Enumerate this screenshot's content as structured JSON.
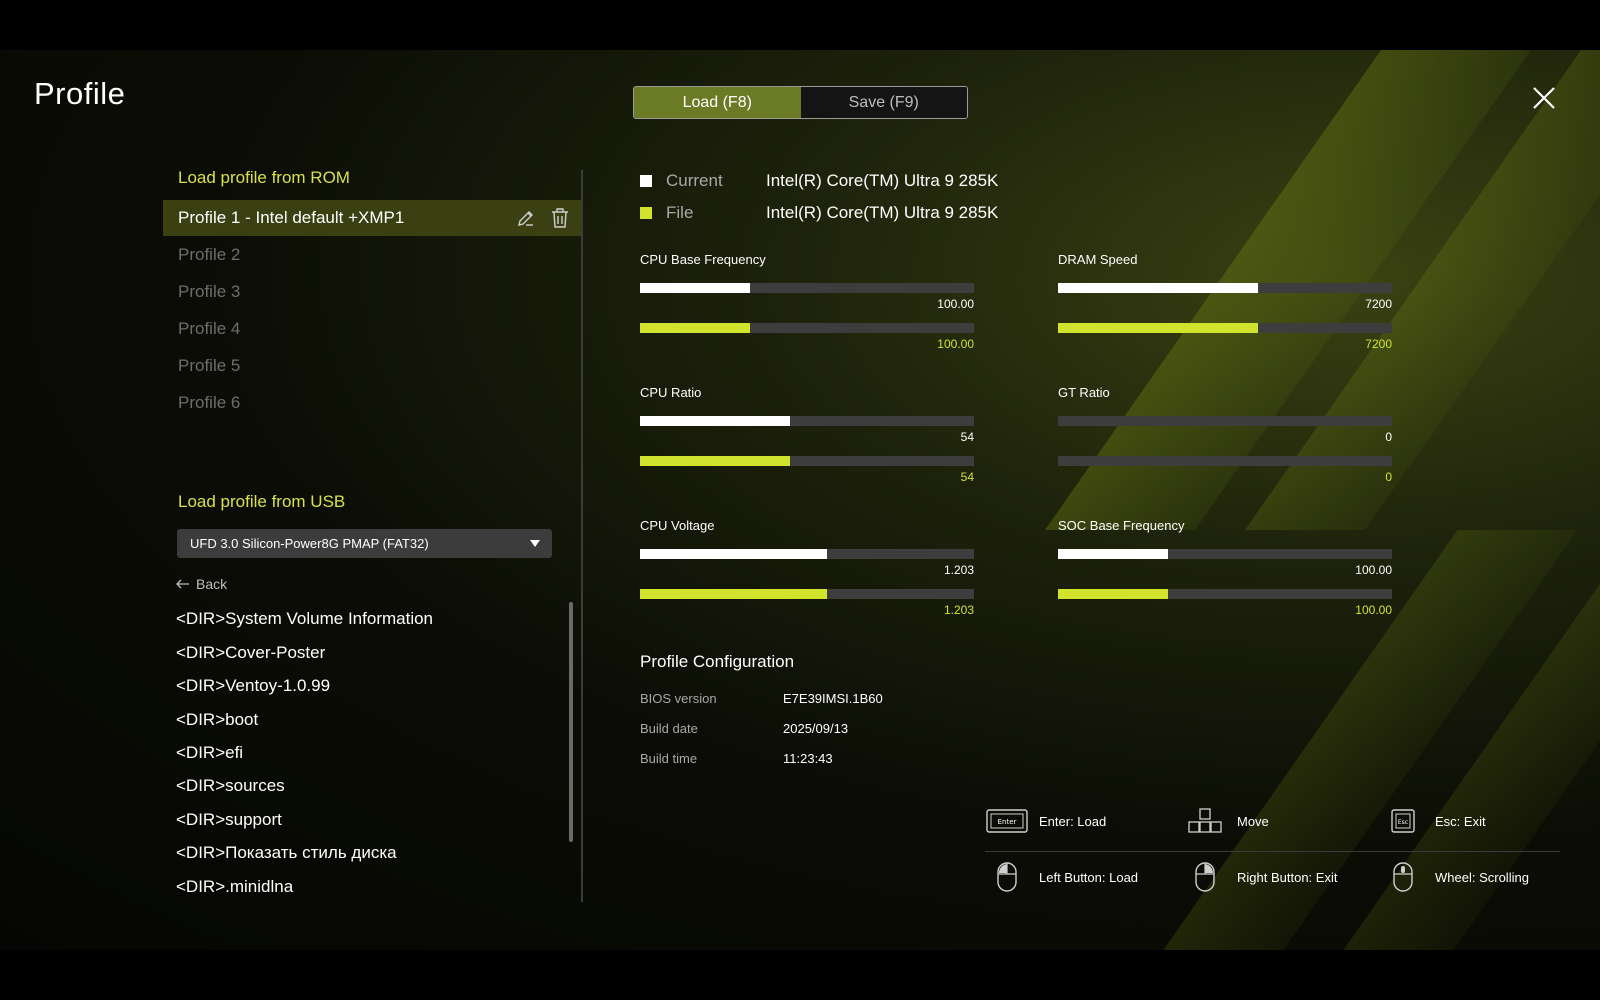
{
  "title": "Profile",
  "close_icon": "close-icon",
  "tabs": {
    "load": "Load (F8)",
    "save": "Save (F9)",
    "active": "load"
  },
  "rom": {
    "section_title": "Load profile from ROM",
    "profiles": [
      "Profile 1 - Intel default +XMP1",
      "Profile 2",
      "Profile 3",
      "Profile 4",
      "Profile 5",
      "Profile 6"
    ],
    "selected_index": 0,
    "row_icons": [
      "edit-icon",
      "trash-icon"
    ]
  },
  "usb": {
    "section_title": "Load profile from USB",
    "device": "UFD 3.0 Silicon-Power8G PMAP (FAT32)",
    "back_label": "Back",
    "entries": [
      "<DIR>System Volume Information",
      "<DIR>Cover-Poster",
      "<DIR>Ventoy-1.0.99",
      "<DIR>boot",
      "<DIR>efi",
      "<DIR>sources",
      "<DIR>support",
      "<DIR>Показать стиль диска",
      "<DIR>.minidlna"
    ]
  },
  "legend": {
    "current": {
      "label": "Current",
      "value": "Intel(R) Core(TM) Ultra 9 285K",
      "color": "#ffffff"
    },
    "file": {
      "label": "File",
      "value": "Intel(R) Core(TM) Ultra 9 285K",
      "color": "#d2e32e"
    }
  },
  "metrics": [
    {
      "label": "CPU Base Frequency",
      "current": "100.00",
      "file": "100.00",
      "current_level": 0.33,
      "file_level": 0.33
    },
    {
      "label": "DRAM Speed",
      "current": "7200",
      "file": "7200",
      "current_level": 0.6,
      "file_level": 0.6
    },
    {
      "label": "CPU Ratio",
      "current": "54",
      "file": "54",
      "current_level": 0.45,
      "file_level": 0.45
    },
    {
      "label": "GT Ratio",
      "current": "0",
      "file": "0",
      "current_level": 0,
      "file_level": 0
    },
    {
      "label": "CPU Voltage",
      "current": "1.203",
      "file": "1.203",
      "current_level": 0.56,
      "file_level": 0.56
    },
    {
      "label": "SOC Base Frequency",
      "current": "100.00",
      "file": "100.00",
      "current_level": 0.33,
      "file_level": 0.33
    }
  ],
  "config": {
    "title": "Profile Configuration",
    "rows": [
      {
        "key": "BIOS version",
        "value": "E7E39IMSI.1B60"
      },
      {
        "key": "Build date",
        "value": "2025/09/13"
      },
      {
        "key": "Build time",
        "value": "11:23:43"
      }
    ]
  },
  "hints": [
    {
      "icon": "enter-key-icon",
      "label": "Enter: Load"
    },
    {
      "icon": "arrow-keys-icon",
      "label": "Move"
    },
    {
      "icon": "esc-key-icon",
      "label": "Esc: Exit"
    },
    {
      "icon": "mouse-left-icon",
      "label": "Left Button: Load"
    },
    {
      "icon": "mouse-right-icon",
      "label": "Right Button: Exit"
    },
    {
      "icon": "mouse-wheel-icon",
      "label": "Wheel: Scrolling"
    }
  ],
  "colors": {
    "accent": "#d2e32e",
    "selected_row": "#3a4012",
    "active_tab": "#6b7a24"
  }
}
